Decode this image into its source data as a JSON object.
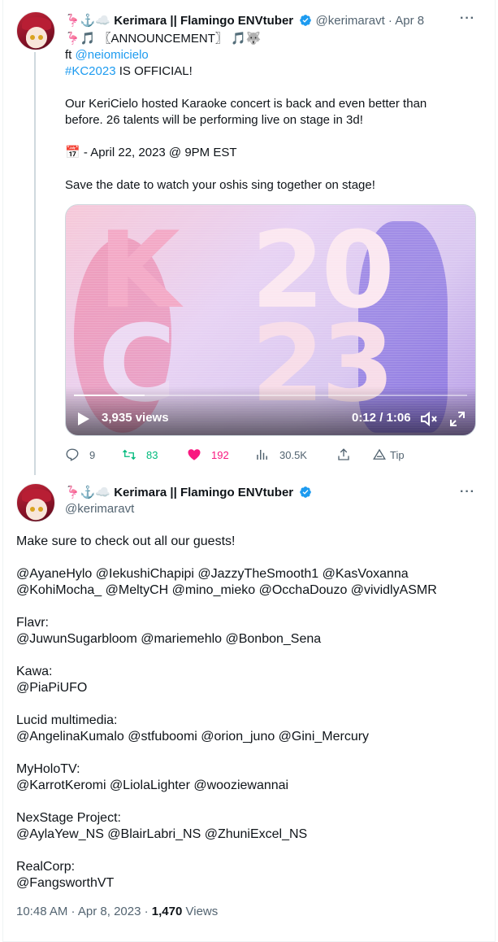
{
  "tweet1": {
    "author_name": "Kerimara || Flamingo ENVtuber",
    "emoji_prefix": "🦩⚓☁️",
    "handle": "@kerimaravt",
    "separator": "·",
    "date": "Apr 8",
    "line1_prefix": "🦩🎵",
    "line1_text": "〖ANNOUNCEMENT〗",
    "line1_suffix": "🎵🐺",
    "ft_label": "ft",
    "ft_mention": "@neiomicielo",
    "hashtag": "#KC2023",
    "official_text": "IS OFFICIAL!",
    "para1_line1": "Our KeriCielo hosted Karaoke concert is back and even better than",
    "para1_line2": "before. 26 talents will be performing live on stage in 3d!",
    "date_emoji": "📅",
    "date_line": "- April 22, 2023 @ 9PM EST",
    "save_line": "Save the date to watch your oshis sing together on stage!",
    "video": {
      "views": "3,935 views",
      "time": "0:12 / 1:06",
      "progress": 0.18,
      "logo_top_left": "K",
      "logo_top_right": "20",
      "logo_bottom_left": "C",
      "logo_bottom_right": "23"
    },
    "actions": {
      "replies": "9",
      "retweets": "83",
      "likes": "192",
      "views": "30.5K",
      "tip": "Tip"
    }
  },
  "tweet2": {
    "author_name": "Kerimara || Flamingo ENVtuber",
    "emoji_prefix": "🦩⚓☁️",
    "handle": "@kerimaravt",
    "intro": "Make sure to check out all our guests!",
    "guests_line1": "@AyaneHylo @IekushiChapipi @JazzyTheSmooth1 @KasVoxanna",
    "guests_line2": "@KohiMocha_ @MeltyCH @mino_mieko @OcchaDouzo @vividlyASMR",
    "groups": [
      {
        "label": "Flavr:",
        "members": "@JuwunSugarbloom @mariemehlo @Bonbon_Sena"
      },
      {
        "label": "Kawa:",
        "members": "@PiaPiUFO"
      },
      {
        "label": "Lucid multimedia:",
        "members": "@AngelinaKumalo @stfuboomi @orion_juno @Gini_Mercury"
      },
      {
        "label": "MyHoloTV:",
        "members": "@KarrotKeromi @LiolaLighter @wooziewannai"
      },
      {
        "label": "NexStage Project:",
        "members": "@AylaYew_NS @BlairLabri_NS @ZhuniExcel_NS"
      },
      {
        "label": "RealCorp:",
        "members": "@FangsworthVT"
      }
    ],
    "footer_time": "10:48 AM · Apr 8, 2023 ·",
    "footer_views_count": "1,470",
    "footer_views_label": "Views"
  },
  "colors": {
    "link": "#1d9bf0",
    "muted": "#536471",
    "retweet": "#00ba7c",
    "like": "#f91880",
    "verified": "#1d9bf0"
  }
}
